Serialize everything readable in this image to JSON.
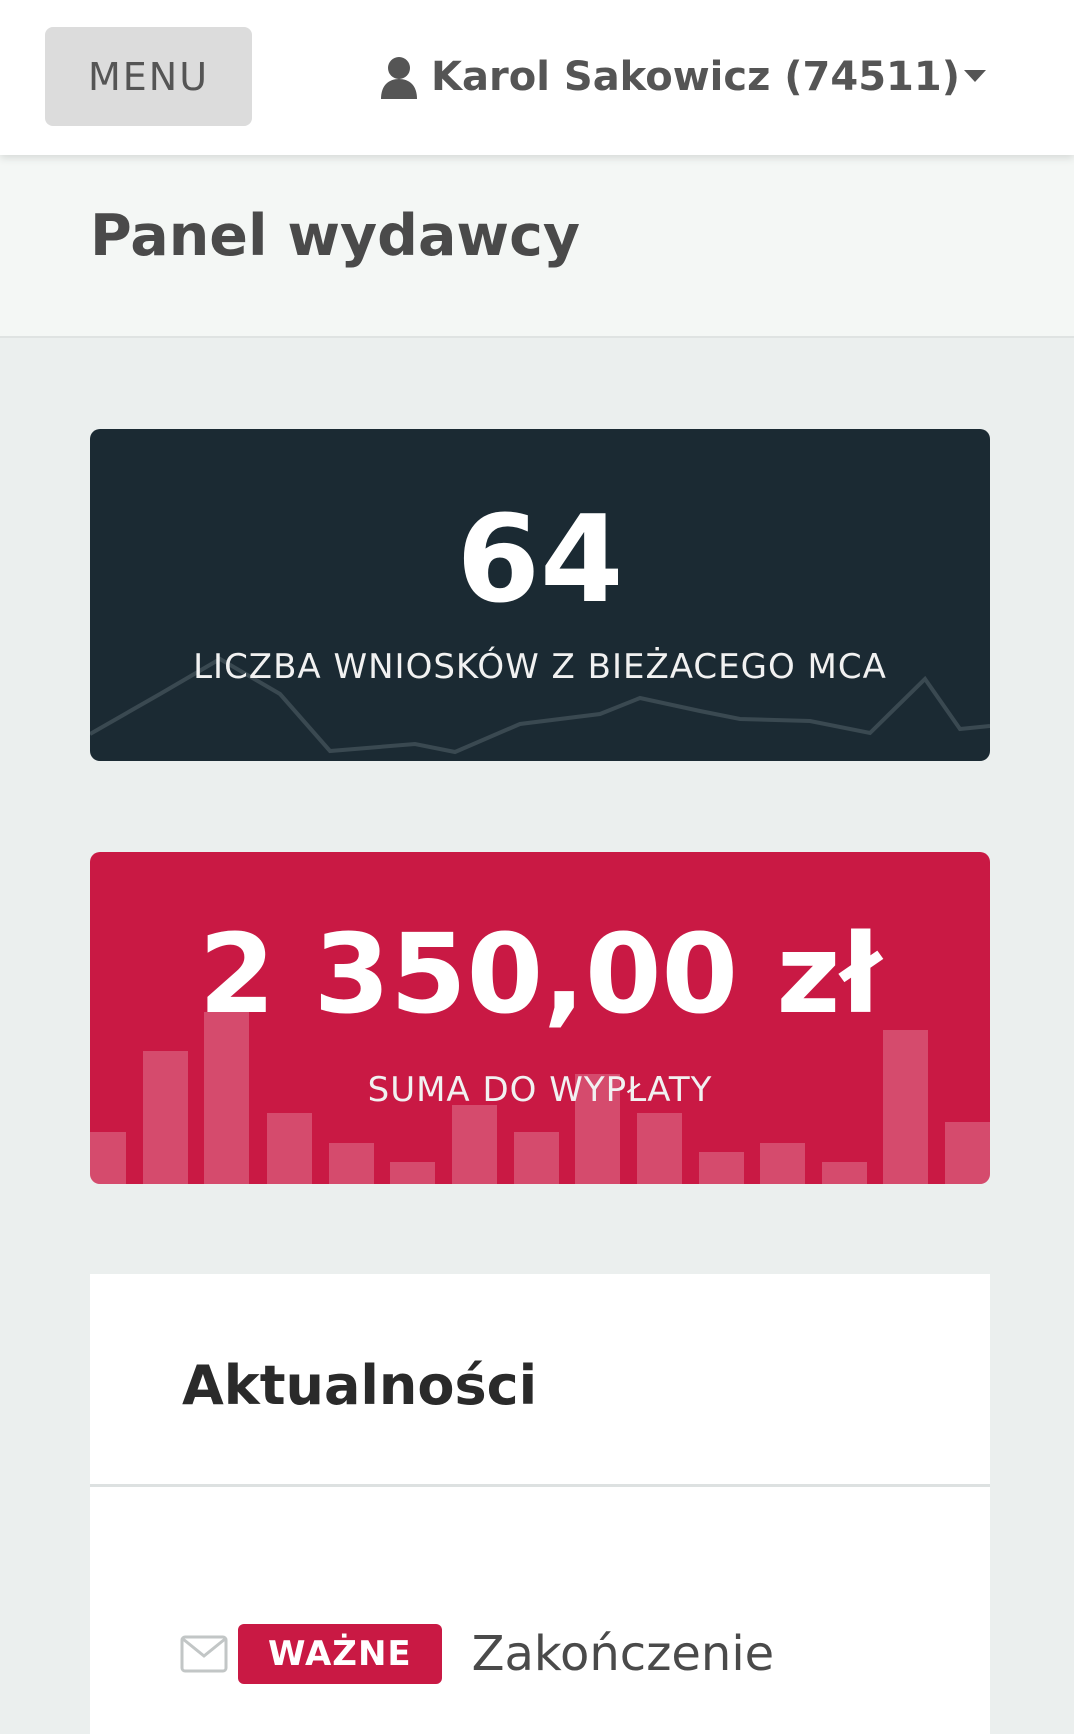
{
  "topbar": {
    "menu_label": "MENU",
    "user_name": "Karol Sakowicz (74511)"
  },
  "page": {
    "title": "Panel wydawcy"
  },
  "stats": {
    "requests_value": "64",
    "requests_label": "LICZBA WNIOSKÓW Z BIEŻACEGO MCA",
    "payout_value": "2 350,00 zł",
    "payout_label": "SUMA DO WYPŁATY"
  },
  "news": {
    "title": "Aktualności",
    "items": [
      {
        "badge": "WAŻNE",
        "text": "Zakończenie"
      }
    ]
  },
  "colors": {
    "dark_card": "#1b2a33",
    "red_card": "#c91944",
    "accent": "#c91944"
  },
  "icons": [
    "user-icon",
    "caret-down-icon",
    "envelope-icon"
  ]
}
